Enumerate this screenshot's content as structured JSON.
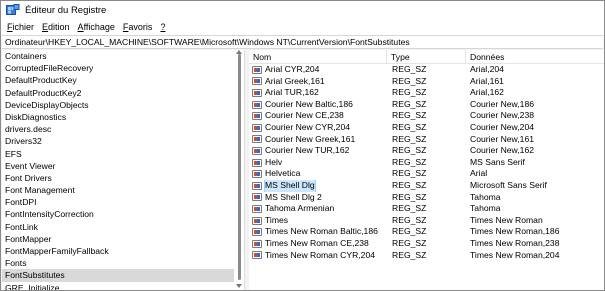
{
  "window": {
    "title": "Éditeur du Registre"
  },
  "menu": [
    {
      "label": "Fichier",
      "accel": "F",
      "rest": "ichier"
    },
    {
      "label": "Edition",
      "accel": "E",
      "rest": "dition"
    },
    {
      "label": "Affichage",
      "accel": "A",
      "rest": "ffichage"
    },
    {
      "label": "Favoris",
      "accel": "F",
      "rest": "avoris"
    },
    {
      "label": "?",
      "accel": "?",
      "rest": ""
    }
  ],
  "address": "Ordinateur\\HKEY_LOCAL_MACHINE\\SOFTWARE\\Microsoft\\Windows NT\\CurrentVersion\\FontSubstitutes",
  "tree": {
    "items": [
      "Containers",
      "CorruptedFileRecovery",
      "DefaultProductKey",
      "DefaultProductKey2",
      "DeviceDisplayObjects",
      "DiskDiagnostics",
      "drivers.desc",
      "Drivers32",
      "EFS",
      "Event Viewer",
      "Font Drivers",
      "Font Management",
      "FontDPI",
      "FontIntensityCorrection",
      "FontLink",
      "FontMapper",
      "FontMapperFamilyFallback",
      "Fonts",
      "FontSubstitutes",
      "GRE_Initialize"
    ],
    "selected": "FontSubstitutes"
  },
  "values": {
    "headers": {
      "name": "Nom",
      "type": "Type",
      "data": "Données"
    },
    "rows": [
      {
        "name": "Arial CYR,204",
        "type": "REG_SZ",
        "data": "Arial,204"
      },
      {
        "name": "Arial Greek,161",
        "type": "REG_SZ",
        "data": "Arial,161"
      },
      {
        "name": "Arial TUR,162",
        "type": "REG_SZ",
        "data": "Arial,162"
      },
      {
        "name": "Courier New Baltic,186",
        "type": "REG_SZ",
        "data": "Courier New,186"
      },
      {
        "name": "Courier New CE,238",
        "type": "REG_SZ",
        "data": "Courier New,238"
      },
      {
        "name": "Courier New CYR,204",
        "type": "REG_SZ",
        "data": "Courier New,204"
      },
      {
        "name": "Courier New Greek,161",
        "type": "REG_SZ",
        "data": "Courier New,161"
      },
      {
        "name": "Courier New TUR,162",
        "type": "REG_SZ",
        "data": "Courier New,162"
      },
      {
        "name": "Helv",
        "type": "REG_SZ",
        "data": "MS Sans Serif"
      },
      {
        "name": "Helvetica",
        "type": "REG_SZ",
        "data": "Arial"
      },
      {
        "name": "MS Shell Dlg",
        "type": "REG_SZ",
        "data": "Microsoft Sans Serif"
      },
      {
        "name": "MS Shell Dlg 2",
        "type": "REG_SZ",
        "data": "Tahoma"
      },
      {
        "name": "Tahoma Armenian",
        "type": "REG_SZ",
        "data": "Tahoma"
      },
      {
        "name": "Times",
        "type": "REG_SZ",
        "data": "Times New Roman"
      },
      {
        "name": "Times New Roman Baltic,186",
        "type": "REG_SZ",
        "data": "Times New Roman,186"
      },
      {
        "name": "Times New Roman CE,238",
        "type": "REG_SZ",
        "data": "Times New Roman,238"
      },
      {
        "name": "Times New Roman CYR,204",
        "type": "REG_SZ",
        "data": "Times New Roman,204"
      }
    ],
    "selected": "MS Shell Dlg"
  }
}
